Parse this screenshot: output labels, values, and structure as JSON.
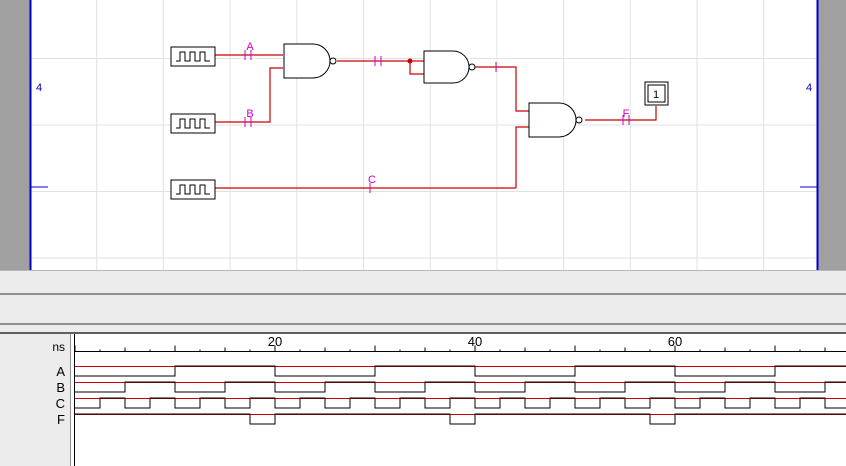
{
  "schematic": {
    "inputs": [
      "A",
      "B",
      "C"
    ],
    "output": "F",
    "probe_value": "1",
    "sheet_border_label": "4",
    "colors": {
      "wire": "#cc0000",
      "label": "#cc00cc",
      "border": "#0000cc",
      "grid": "#e2e2e2"
    }
  },
  "waveform": {
    "unit_label": "ns",
    "time_range": [
      0,
      77
    ],
    "major_ticks": [
      20,
      40,
      60
    ],
    "minor_step_ns": 2.5,
    "signals": [
      {
        "name": "A",
        "initial": 0,
        "transitions": [
          10,
          20,
          30,
          40,
          50,
          60,
          70
        ]
      },
      {
        "name": "B",
        "initial": 0,
        "transitions": [
          5,
          10,
          15,
          20,
          25,
          30,
          35,
          40,
          45,
          50,
          55,
          60,
          65,
          70,
          75
        ]
      },
      {
        "name": "C",
        "initial": 0,
        "transitions": [
          2.5,
          5,
          7.5,
          10,
          12.5,
          15,
          17.5,
          20,
          22.5,
          25,
          27.5,
          30,
          32.5,
          35,
          37.5,
          40,
          42.5,
          45,
          47.5,
          50,
          52.5,
          55,
          57.5,
          60,
          62.5,
          65,
          67.5,
          70,
          72.5,
          75
        ]
      },
      {
        "name": "F",
        "initial": 1,
        "transitions": [
          17.5,
          20,
          37.5,
          40,
          57.5,
          60
        ]
      }
    ],
    "colors": {
      "trace": "#000000",
      "high_marker": "#cc0000"
    }
  }
}
